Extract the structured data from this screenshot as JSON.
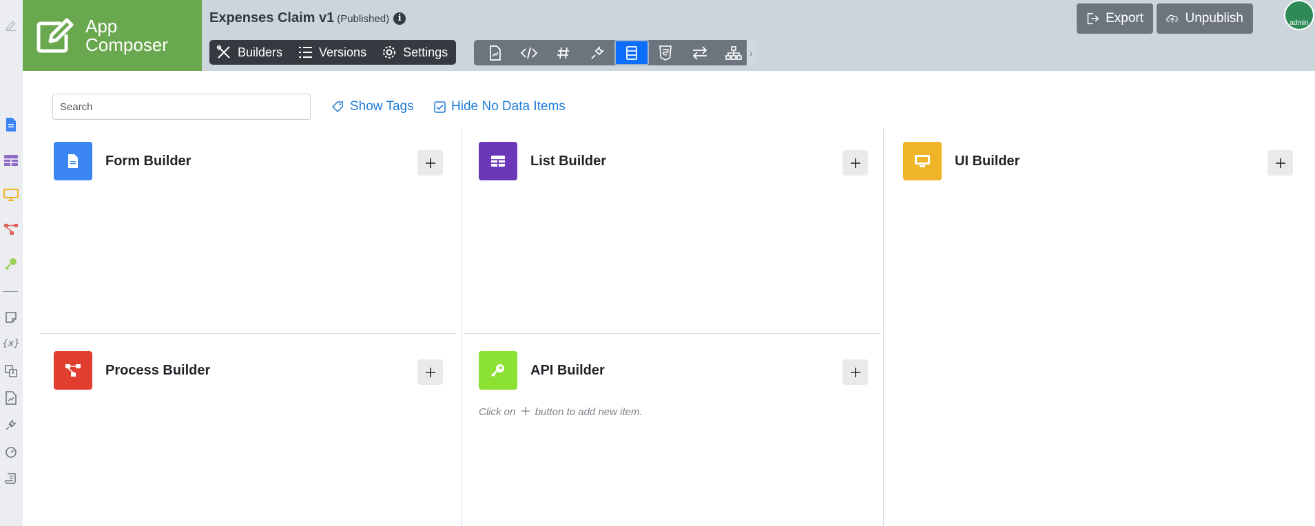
{
  "app": {
    "name_line1": "App",
    "name_line2": "Composer",
    "title": "Expenses Claim v1",
    "status": "(Published)",
    "info_glyph": "i"
  },
  "nav": {
    "builders": "Builders",
    "versions": "Versions",
    "settings": "Settings"
  },
  "header_actions": {
    "export": "Export",
    "unpublish": "Unpublish"
  },
  "user": {
    "avatar_text": "admin"
  },
  "toolbar_more": "›",
  "search": {
    "placeholder": "Search"
  },
  "links": {
    "show_tags": "Show Tags",
    "hide_no_data": "Hide No Data Items"
  },
  "panels": {
    "form": {
      "title": "Form Builder",
      "color": "#3c86f4"
    },
    "list": {
      "title": "List Builder",
      "color": "#6a37b8"
    },
    "ui": {
      "title": "UI Builder",
      "color": "#f0b429"
    },
    "process": {
      "title": "Process Builder",
      "color": "#e03e2f"
    },
    "api": {
      "title": "API Builder",
      "color": "#8be233"
    }
  },
  "api_hint": {
    "before": "Click on",
    "after": "button to add new item."
  },
  "colors": {
    "logo_green": "#6aa84f",
    "header_bg": "#ccd4dc",
    "navbar_dark": "#343a40",
    "toolbar_gray": "#6c757d",
    "active_blue": "#0d6efd",
    "link_blue": "#1f7bd8"
  }
}
